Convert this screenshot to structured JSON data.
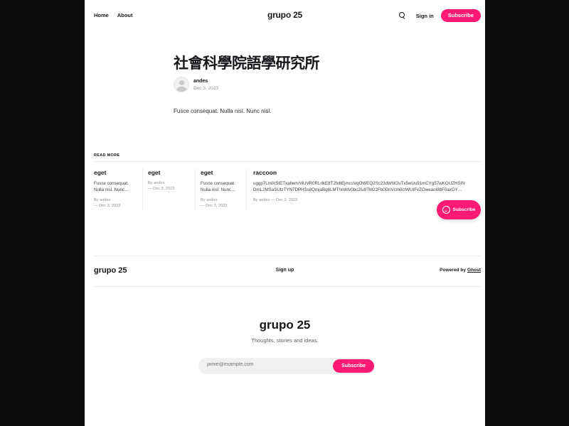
{
  "header": {
    "nav": [
      "Home",
      "About"
    ],
    "brand": "grupo 25",
    "search_icon": "search-icon",
    "signin_label": "Sign in",
    "subscribe_label": "Subscribe",
    "accent_color": "#ff1a75"
  },
  "post": {
    "title": "社會科學院語學研究所",
    "author": "andes",
    "date": "Dec 3, 2023",
    "body": "Fusce consequat. Nulla nisl. Nunc nisl."
  },
  "read_more": {
    "label": "READ MORE",
    "cards": [
      {
        "title": "eget",
        "excerpt1": "Fusce consequat.",
        "excerpt2": "Nulla nisl. Nunc…",
        "byline": "By andes",
        "date": "— Dec 3, 2023"
      },
      {
        "title": "eget",
        "excerpt1": "",
        "excerpt2": "",
        "byline": "By andes",
        "date": "— Dec 3, 2023"
      },
      {
        "title": "eget",
        "excerpt1": "Fusce consequat.",
        "excerpt2": "Nulla nisl. Nunc…",
        "byline": "By andes",
        "date": "— Dec 3, 2023"
      },
      {
        "title": "raccoon",
        "excerpt1": "uggp7LmlXStETxahwrvViUVR0RLrlkE8T2fx6EjmcsVqOWEQ2Sc23dWW2uTx5wUu91mCYg57wKOUZHSIN",
        "excerpt2": "DmL2MSaSUtzTYN7DPHSs8QmjaBq6LMThmhtv0bc2Iu9TM22Fb0DnVcm0ctWUIFvZOweaoI88F0axGY…",
        "byline": "By andes",
        "date": "— Dec 3, 2023"
      }
    ]
  },
  "floating_subscribe": {
    "label": "Subscribe",
    "icon": "smile-icon"
  },
  "footer": {
    "brand": "grupo 25",
    "signup": "Sign up",
    "powered_prefix": "Powered by",
    "powered_link": "Ghost"
  },
  "subscribe_box": {
    "brand": "grupo 25",
    "tagline": "Thoughts, stories and ideas.",
    "placeholder": "jamie@example.com",
    "button": "Subscribe"
  }
}
